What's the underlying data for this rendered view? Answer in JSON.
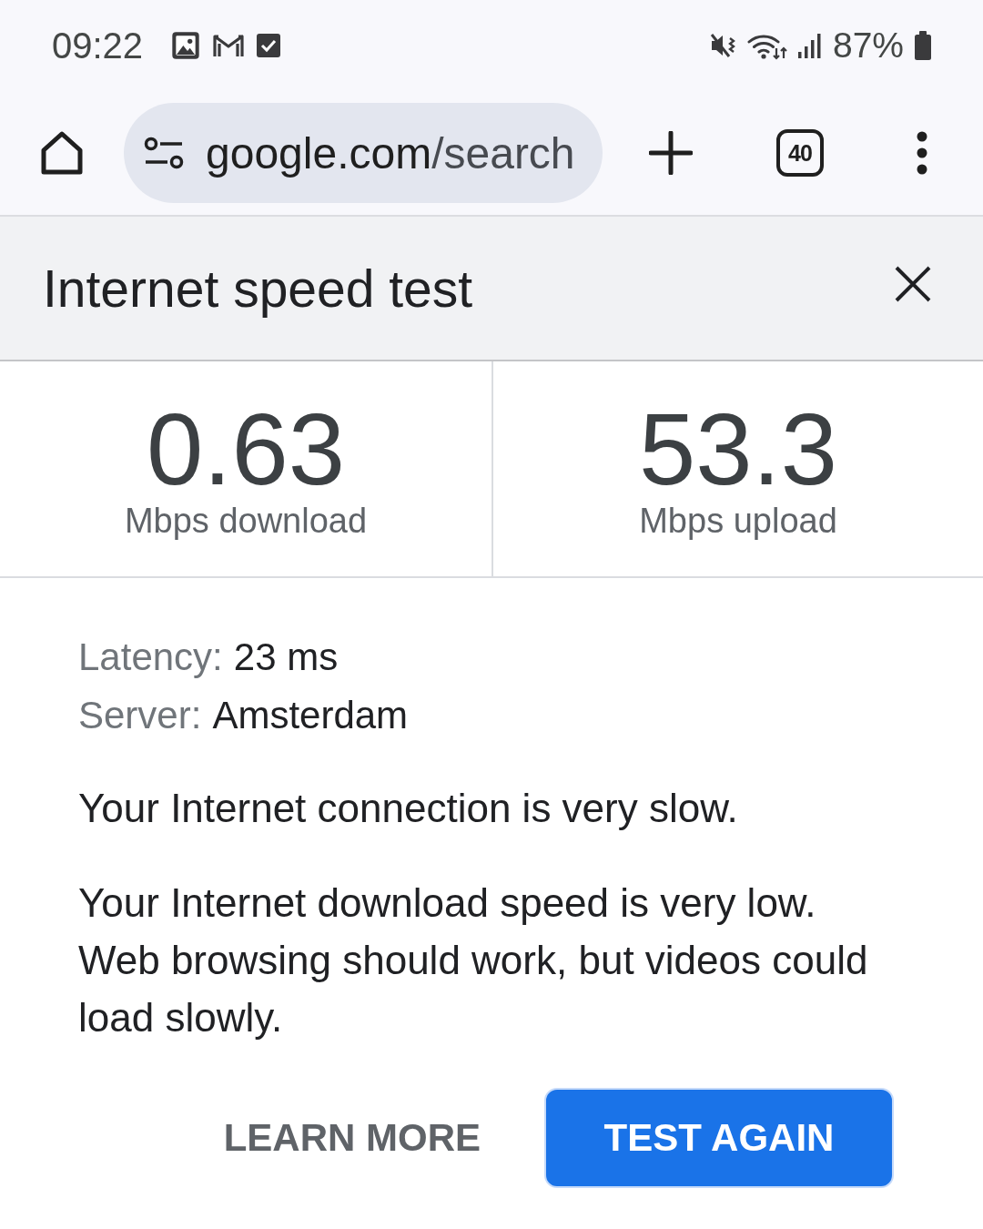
{
  "status_bar": {
    "time": "09:22",
    "battery_percent": "87%"
  },
  "toolbar": {
    "address": {
      "host": "google.com",
      "path": "/search"
    },
    "tab_count": "40"
  },
  "card": {
    "title": "Internet speed test",
    "results": [
      {
        "value": "0.63",
        "unit": "Mbps download"
      },
      {
        "value": "53.3",
        "unit": "Mbps upload"
      }
    ],
    "details": [
      {
        "label": "Latency:",
        "value": "23 ms"
      },
      {
        "label": "Server:",
        "value": "Amsterdam"
      }
    ],
    "summary": "Your Internet connection is very slow.",
    "description": "Your Internet download speed is very low.\nWeb browsing should work, but videos could load slowly.",
    "buttons": [
      {
        "label": "LEARN MORE",
        "kind": "text"
      },
      {
        "label": "TEST AGAIN",
        "kind": "filled"
      }
    ]
  }
}
